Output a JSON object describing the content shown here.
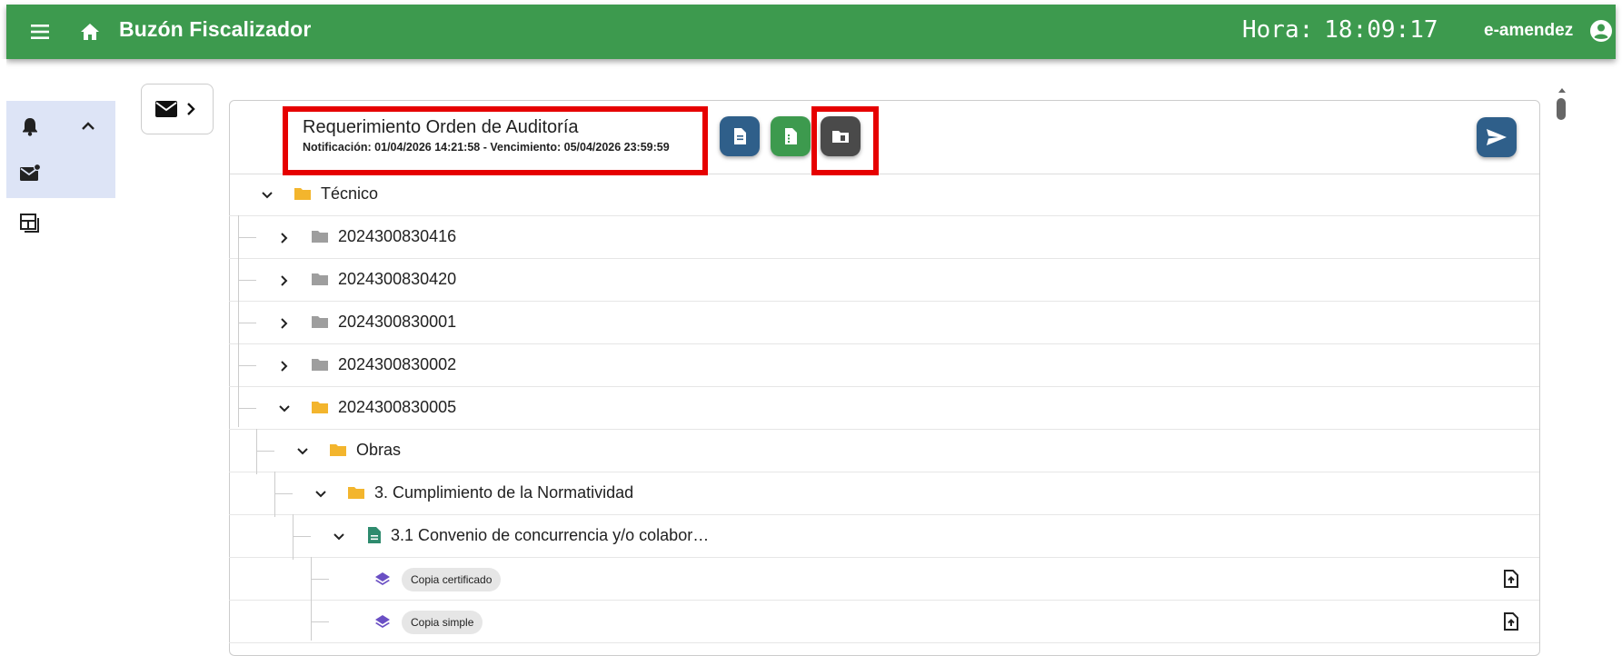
{
  "header": {
    "app_title": "Buzón Fiscalizador",
    "clock_label": "Hora:",
    "clock_time": "18:09:17",
    "username": "e-amendez"
  },
  "sidebar": {
    "items": [
      {
        "icon": "bell-icon"
      },
      {
        "icon": "mail-badge-icon"
      },
      {
        "icon": "layout-icon"
      }
    ]
  },
  "requirement": {
    "title": "Requerimiento Orden de Auditoría",
    "subtitle": "Notificación: 01/04/2026 14:21:58 - Vencimiento: 05/04/2026 23:59:59"
  },
  "actions": [
    {
      "name": "document-button",
      "color": "#2f5f8a"
    },
    {
      "name": "spreadsheet-button",
      "color": "#3d9a4e"
    },
    {
      "name": "folder-download-button",
      "color": "#4a4a4a"
    }
  ],
  "send_color": "#2f5f8a",
  "tree": [
    {
      "label": "Técnico",
      "expanded": true,
      "type": "folder",
      "folder_color": "#f3b52d"
    },
    {
      "label": "2024300830416",
      "expanded": false,
      "type": "folder",
      "folder_color": "#9e9e9e"
    },
    {
      "label": "2024300830420",
      "expanded": false,
      "type": "folder",
      "folder_color": "#9e9e9e"
    },
    {
      "label": "2024300830001",
      "expanded": false,
      "type": "folder",
      "folder_color": "#9e9e9e"
    },
    {
      "label": "2024300830002",
      "expanded": false,
      "type": "folder",
      "folder_color": "#9e9e9e"
    },
    {
      "label": "2024300830005",
      "expanded": true,
      "type": "folder",
      "folder_color": "#f3b52d"
    },
    {
      "label": "Obras",
      "expanded": true,
      "type": "folder",
      "folder_color": "#f3b52d"
    },
    {
      "label": "3. Cumplimiento de la Normatividad",
      "expanded": true,
      "type": "folder",
      "folder_color": "#f3b52d"
    },
    {
      "label": "3.1 Convenio de concurrencia y/o colabor…",
      "expanded": true,
      "type": "document"
    },
    {
      "label": "Copia certificado",
      "type": "chip"
    },
    {
      "label": "Copia simple",
      "type": "chip"
    }
  ]
}
